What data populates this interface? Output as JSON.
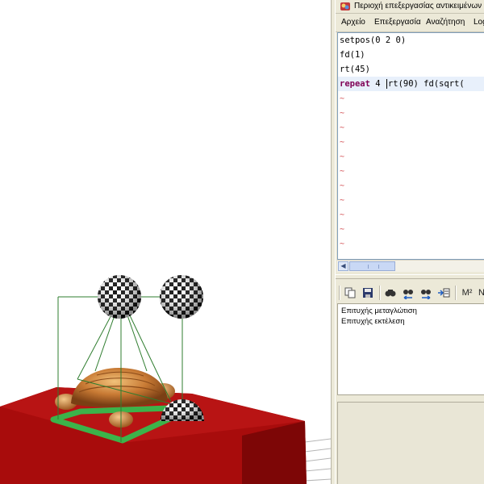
{
  "window": {
    "title": "Περιοχή επεξεργασίας αντικειμένων"
  },
  "menu": {
    "items": [
      "Αρχείο",
      "Επεξεργασία",
      "Αναζήτηση",
      "Log"
    ]
  },
  "editor": {
    "lines": [
      "setpos(0 2 0)",
      "fd(1)",
      "rt(45)"
    ],
    "current_keyword": "repeat",
    "current_count": "4",
    "current_rest": "rt(90) fd(sqrt(",
    "empty_line_marker": "~"
  },
  "toolbar": {
    "icons": [
      "copy-icon",
      "save-icon",
      "find-icon",
      "find-previous-icon",
      "find-next-icon",
      "insert-icon",
      "mass-icon"
    ],
    "mass_label": "M²",
    "overflow_label": "N"
  },
  "console": {
    "lines": [
      "Επιτυχής μεταγλώτιση",
      "Επιτυχής εκτέλεση"
    ]
  },
  "colors": {
    "block_red": "#a80c0c",
    "pad_green": "#3cb34a",
    "wire_green": "#2f7d2f",
    "shell_brown": "#c87a34",
    "panel_bg": "#ece9d8",
    "keyword": "#7f0055",
    "tilde": "#d0454a"
  }
}
